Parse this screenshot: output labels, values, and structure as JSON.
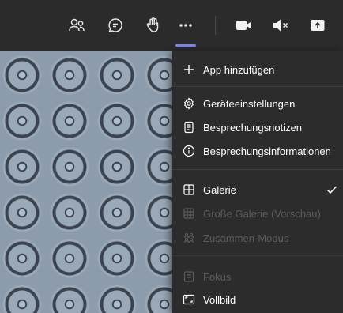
{
  "toolbar": {
    "icons": [
      "participants-icon",
      "chat-icon",
      "raise-hand-icon",
      "more-icon",
      "camera-icon",
      "mute-icon",
      "share-icon"
    ]
  },
  "menu": {
    "items": [
      {
        "label": "App hinzufügen",
        "icon": "plus-icon",
        "enabled": true
      },
      {
        "label": "Geräteeinstellungen",
        "icon": "gear-icon",
        "enabled": true
      },
      {
        "label": "Besprechungsnotizen",
        "icon": "notes-icon",
        "enabled": true
      },
      {
        "label": "Besprechungsinformationen",
        "icon": "info-icon",
        "enabled": true
      },
      {
        "label": "Galerie",
        "icon": "gallery-icon",
        "enabled": true,
        "checked": true
      },
      {
        "label": "Große Galerie (Vorschau)",
        "icon": "large-gallery-icon",
        "enabled": false
      },
      {
        "label": "Zusammen-Modus",
        "icon": "together-mode-icon",
        "enabled": false
      },
      {
        "label": "Fokus",
        "icon": "focus-icon",
        "enabled": false
      },
      {
        "label": "Vollbild",
        "icon": "fullscreen-icon",
        "enabled": true
      }
    ]
  },
  "colors": {
    "toolbar_bg": "#2b2b2b",
    "menu_bg": "#2d2c2c",
    "accent": "#7f85f5",
    "text": "#ffffff",
    "disabled_text": "#5c5c5c"
  }
}
